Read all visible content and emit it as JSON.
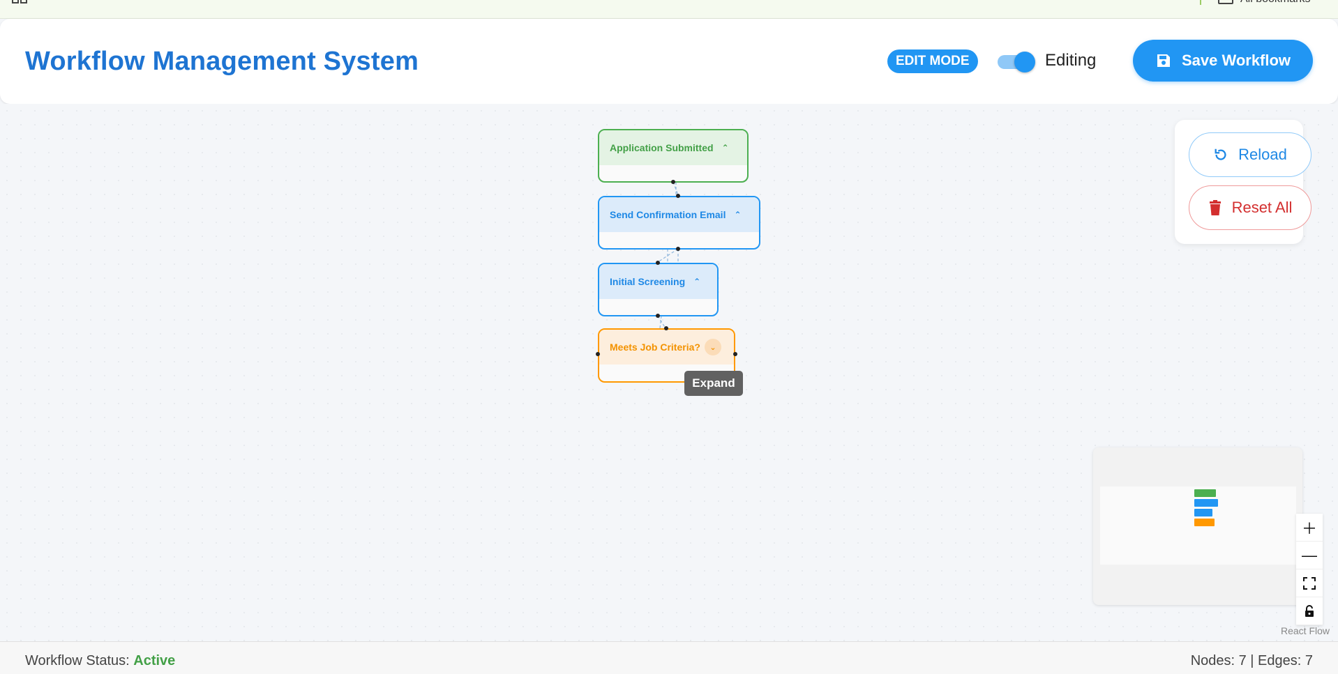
{
  "browser": {
    "all_bookmarks": "All bookmarks"
  },
  "header": {
    "title": "Workflow Management System",
    "mode_badge": "EDIT MODE",
    "toggle_label": "Editing",
    "toggle_on": true,
    "save_label": "Save Workflow"
  },
  "nodes": [
    {
      "label": "Application Submitted",
      "color": "green",
      "expanded": true
    },
    {
      "label": "Send Confirmation Email",
      "color": "blue",
      "expanded": true
    },
    {
      "label": "Initial Screening",
      "color": "blue",
      "expanded": true
    },
    {
      "label": "Meets Job Criteria?",
      "color": "orange",
      "expanded": false
    }
  ],
  "tooltip": "Expand",
  "panel": {
    "reload_label": "Reload",
    "reset_label": "Reset All"
  },
  "controls": {
    "zoom_in_icon": "plus-icon",
    "zoom_out_icon": "minus-icon",
    "fit_view_icon": "fit-view-icon",
    "lock_icon": "lock-icon"
  },
  "attribution": "React Flow",
  "footer": {
    "status_label": "Workflow Status:",
    "status_value": "Active",
    "stats": "Nodes: 7 | Edges: 7"
  },
  "colors": {
    "primary": "#2196f3",
    "success": "#4caf50",
    "warning": "#ff9800",
    "danger": "#d32f2f"
  }
}
